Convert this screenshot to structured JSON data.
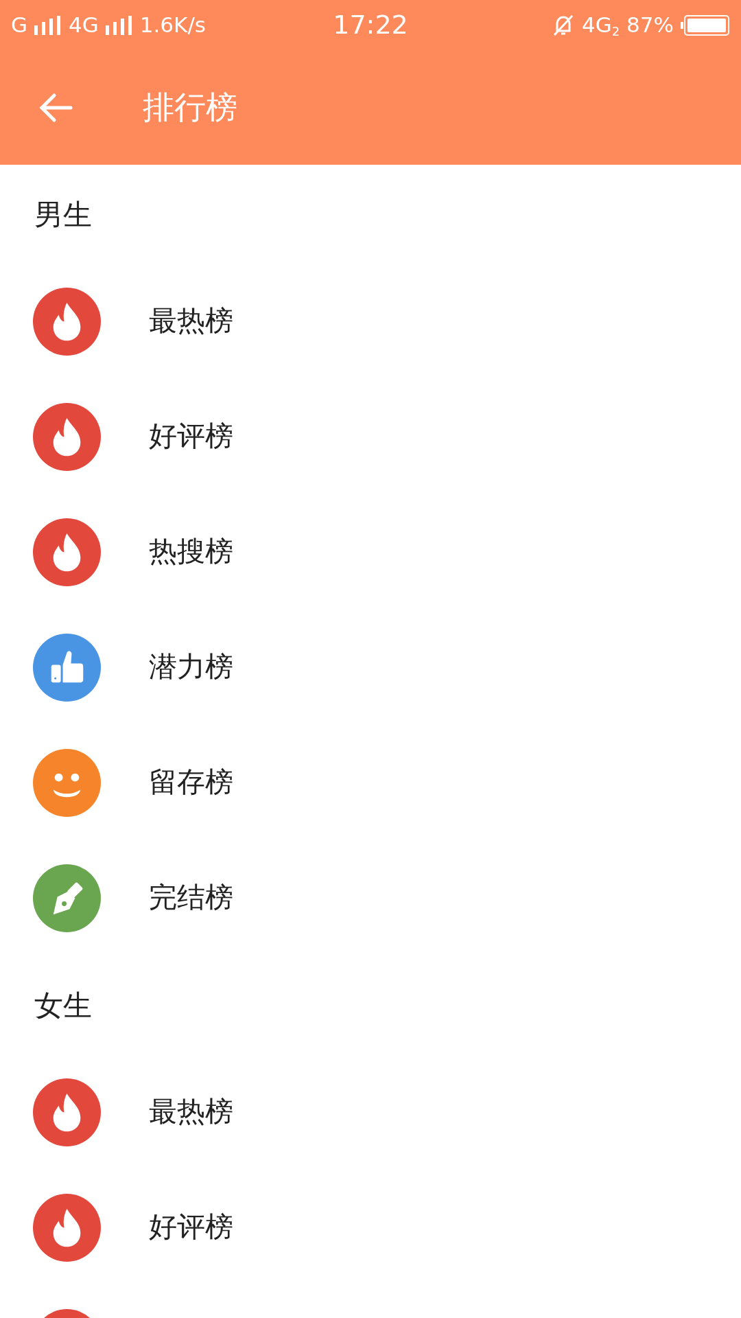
{
  "status_bar": {
    "carrier_1": "G",
    "carrier_2": "4G",
    "speed": "1.6K/s",
    "time": "17:22",
    "network": "4G",
    "sim_index": "2",
    "battery": "87%"
  },
  "header": {
    "title": "排行榜"
  },
  "sections": [
    {
      "title": "男生",
      "items": [
        {
          "kind": "hot",
          "label": "最热榜"
        },
        {
          "kind": "hot",
          "label": "好评榜"
        },
        {
          "kind": "hot",
          "label": "热搜榜"
        },
        {
          "kind": "like",
          "label": "潜力榜"
        },
        {
          "kind": "smile",
          "label": "留存榜"
        },
        {
          "kind": "pen",
          "label": "完结榜"
        }
      ]
    },
    {
      "title": "女生",
      "items": [
        {
          "kind": "hot",
          "label": "最热榜"
        },
        {
          "kind": "hot",
          "label": "好评榜"
        },
        {
          "kind": "hot"
        }
      ]
    }
  ]
}
